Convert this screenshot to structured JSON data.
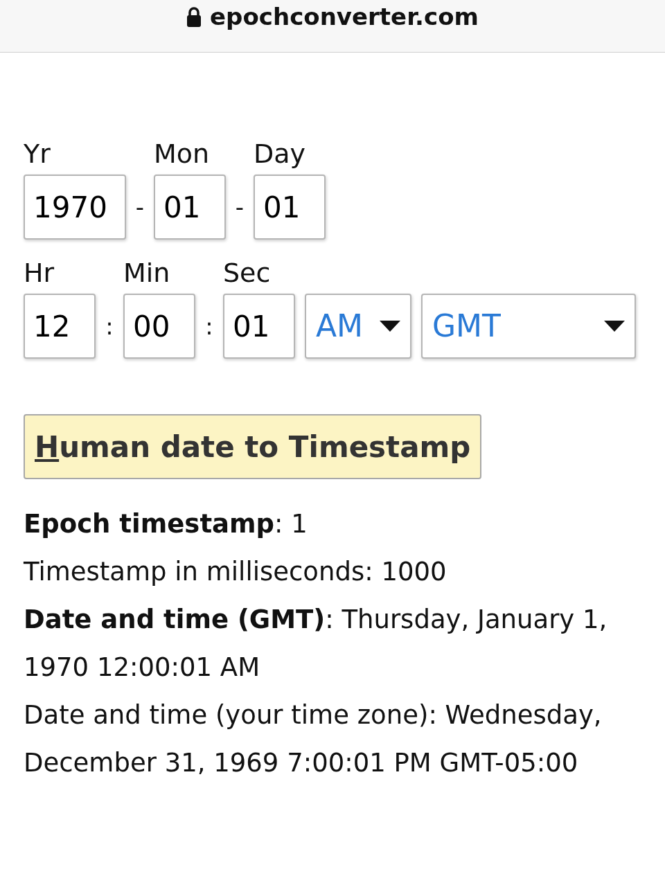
{
  "address_bar": {
    "url": "epochconverter.com"
  },
  "date_row": [
    {
      "label": "Yr",
      "value": "1970",
      "separator": "-"
    },
    {
      "label": "Mon",
      "value": "01",
      "separator": "-"
    },
    {
      "label": "Day",
      "value": "01"
    }
  ],
  "time_row": [
    {
      "label": "Hr",
      "value": "12",
      "separator": ":"
    },
    {
      "label": "Min",
      "value": "00",
      "separator": ":"
    },
    {
      "label": "Sec",
      "value": "01"
    }
  ],
  "ampm_select": {
    "value": "AM"
  },
  "timezone_select": {
    "value": "GMT"
  },
  "convert_button": {
    "label": "Human date to Timestamp"
  },
  "results": [
    {
      "text": "**Epoch timestamp**: 1"
    },
    {
      "text": "Timestamp in milliseconds: 1000"
    },
    {
      "text": "**Date and time (GMT)**: Thursday, January 1, 1970 12:00:01 AM"
    },
    {
      "text": "Date and time (your time zone): Wednesday, December 31, 1969 7:00:01 PM GMT-05:00"
    }
  ]
}
